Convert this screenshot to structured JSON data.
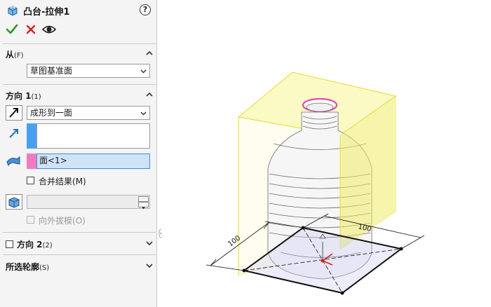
{
  "title": "凸台-拉伸1",
  "help_glyph": "?",
  "from_section": {
    "label": "从",
    "shortcut": "(F)",
    "value": "草图基准面"
  },
  "direction1": {
    "label": "方向 1",
    "shortcut": "(1)",
    "end_condition": "成形到一面",
    "face_field": "面<1>",
    "merge_result": {
      "label": "合并结果",
      "shortcut": "(M)",
      "checked": false
    },
    "draft_outward": {
      "label": "向外拔模",
      "shortcut": "(O)",
      "checked": false,
      "enabled": false
    }
  },
  "direction2": {
    "label": "方向 2",
    "shortcut": "(2)",
    "checked": false
  },
  "selected_contours": {
    "label": "所选轮廓",
    "shortcut": "(S)"
  },
  "viewport": {
    "dim_a": "100",
    "dim_b": "100"
  },
  "colors": {
    "accent_blue": "#3c8de0",
    "confirm_green": "#2a9a2a",
    "cancel_red": "#d42020",
    "swatch_blue": "#4aa0f0",
    "swatch_pink": "#f07cc0",
    "preview_yellow": "#f2ee6a"
  }
}
